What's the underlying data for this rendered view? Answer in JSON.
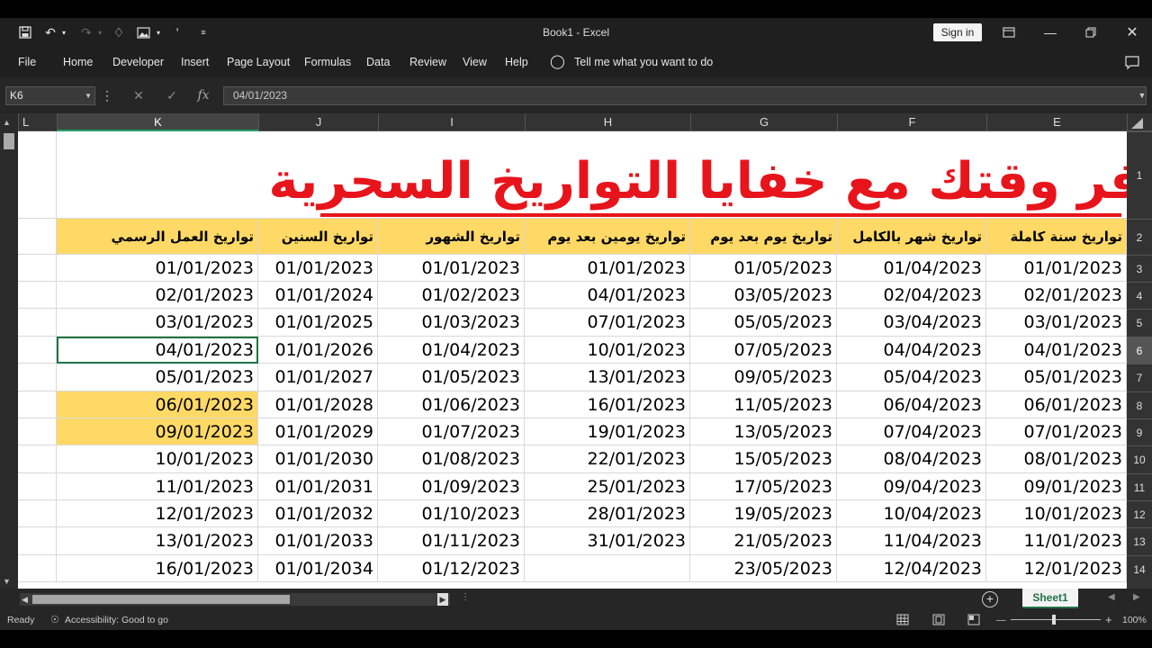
{
  "window": {
    "title": "Book1  -  Excel",
    "sign_in": "Sign in"
  },
  "ribbon": {
    "tabs": [
      "File",
      "Home",
      "Developer",
      "Insert",
      "Page Layout",
      "Formulas",
      "Data",
      "Review",
      "View",
      "Help"
    ],
    "tell_me": "Tell me what you want to do"
  },
  "formula_bar": {
    "name_box": "K6",
    "content": "04/01/2023"
  },
  "columns": [
    "L",
    "K",
    "J",
    "I",
    "H",
    "G",
    "F",
    "E"
  ],
  "selected_column": "K",
  "rows": [
    "1",
    "2",
    "3",
    "4",
    "5",
    "6",
    "7",
    "8",
    "9",
    "10",
    "11",
    "12",
    "13",
    "14"
  ],
  "selected_row": "6",
  "banner_title": "وفر وقتك مع خفايا التواريخ السحرية",
  "headers": {
    "K": "تواريخ العمل الرسمي",
    "J": "تواريخ السنين",
    "I": "تواريخ الشهور",
    "H": "تواريخ يومين بعد يوم",
    "G": "تواريخ يوم بعد يوم",
    "F": "تواريخ شهر بالكامل",
    "E": "تواريخ سنة كاملة"
  },
  "table": {
    "K": [
      "01/01/2023",
      "02/01/2023",
      "03/01/2023",
      "04/01/2023",
      "05/01/2023",
      "06/01/2023",
      "09/01/2023",
      "10/01/2023",
      "11/01/2023",
      "12/01/2023",
      "13/01/2023",
      "16/01/2023"
    ],
    "J": [
      "01/01/2023",
      "01/01/2024",
      "01/01/2025",
      "01/01/2026",
      "01/01/2027",
      "01/01/2028",
      "01/01/2029",
      "01/01/2030",
      "01/01/2031",
      "01/01/2032",
      "01/01/2033",
      "01/01/2034"
    ],
    "I": [
      "01/01/2023",
      "01/02/2023",
      "01/03/2023",
      "01/04/2023",
      "01/05/2023",
      "01/06/2023",
      "01/07/2023",
      "01/08/2023",
      "01/09/2023",
      "01/10/2023",
      "01/11/2023",
      "01/12/2023"
    ],
    "H": [
      "01/01/2023",
      "04/01/2023",
      "07/01/2023",
      "10/01/2023",
      "13/01/2023",
      "16/01/2023",
      "19/01/2023",
      "22/01/2023",
      "25/01/2023",
      "28/01/2023",
      "31/01/2023",
      ""
    ],
    "G": [
      "01/05/2023",
      "03/05/2023",
      "05/05/2023",
      "07/05/2023",
      "09/05/2023",
      "11/05/2023",
      "13/05/2023",
      "15/05/2023",
      "17/05/2023",
      "19/05/2023",
      "21/05/2023",
      "23/05/2023"
    ],
    "F": [
      "01/04/2023",
      "02/04/2023",
      "03/04/2023",
      "04/04/2023",
      "05/04/2023",
      "06/04/2023",
      "07/04/2023",
      "08/04/2023",
      "09/04/2023",
      "10/04/2023",
      "11/04/2023",
      "12/04/2023"
    ],
    "E": [
      "01/01/2023",
      "02/01/2023",
      "03/01/2023",
      "04/01/2023",
      "05/01/2023",
      "06/01/2023",
      "07/01/2023",
      "08/01/2023",
      "09/01/2023",
      "10/01/2023",
      "11/01/2023",
      "12/01/2023"
    ]
  },
  "sheet_tab": "Sheet1",
  "status": {
    "ready": "Ready",
    "accessibility": "Accessibility: Good to go",
    "zoom": "100%"
  },
  "colors": {
    "header_fill": "#ffd966",
    "banner_red": "#e8141b",
    "excel_green": "#217346"
  }
}
